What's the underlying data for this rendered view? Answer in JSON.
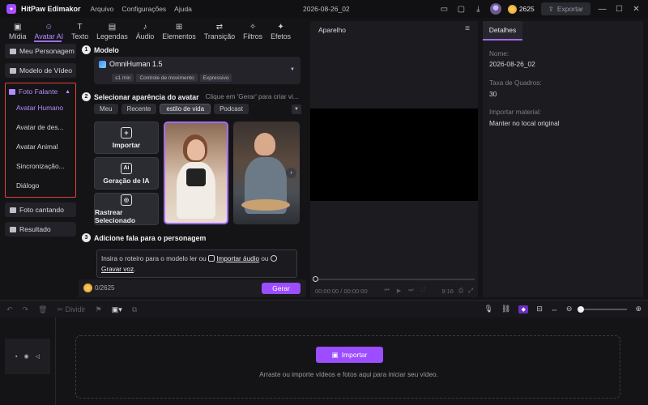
{
  "app": {
    "name": "HitPaw Edimakor",
    "document_title": "2026-08-26_02"
  },
  "menu": [
    "Arquivo",
    "Configurações",
    "Ajuda"
  ],
  "titlebar": {
    "credits": "2625",
    "export_label": "Exportar"
  },
  "tools": [
    {
      "label": "Mídia",
      "icon": "media-icon"
    },
    {
      "label": "Avatar AI",
      "icon": "avatar-ai-icon"
    },
    {
      "label": "Texto",
      "icon": "text-icon"
    },
    {
      "label": "Legendas",
      "icon": "captions-icon"
    },
    {
      "label": "Áudio",
      "icon": "audio-icon"
    },
    {
      "label": "Elementos",
      "icon": "elements-icon"
    },
    {
      "label": "Transição",
      "icon": "transition-icon"
    },
    {
      "label": "Filtros",
      "icon": "filters-icon"
    },
    {
      "label": "Efetos",
      "icon": "effects-icon"
    }
  ],
  "sidebar": {
    "items_top": [
      "Meu Personagem",
      "Modelo de Vídeo"
    ],
    "foto_falante": {
      "label": "Foto Falante",
      "subitems": [
        "Avatar Humano",
        "Avatar de des...",
        "Avatar Animal",
        "Sincronização...",
        "Diálogo"
      ]
    },
    "items_bottom": [
      "Foto cantando",
      "Resultado"
    ]
  },
  "panel": {
    "step1": {
      "num": "1",
      "title": "Modelo"
    },
    "model": {
      "name": "OmniHuman 1.5",
      "tags": [
        "≤1 min",
        "Controle de movimento",
        "Expressivo"
      ]
    },
    "step2": {
      "num": "2",
      "title": "Selecionar aparência do avatar",
      "hint": "Clique em 'Gerar' para criar vi..."
    },
    "filters": [
      "Meu",
      "Recente",
      "estilo de vida",
      "Podcast"
    ],
    "actions": {
      "import": "Importar",
      "ai": "Geração de IA",
      "track": "Rastrear Selecionado"
    },
    "step3": {
      "num": "3",
      "title": "Adicione fala para o personagem"
    },
    "script": {
      "prefix": "Insira o roteiro para o modelo ler ou",
      "import_audio": "Importar áudio",
      "or": "ou",
      "record": "Gravar voz",
      "suffix": "."
    },
    "credits": "0/2625",
    "generate": "Gerar"
  },
  "preview": {
    "title": "Aparelho",
    "time": "00:00:00 / 00:00:00",
    "aspect": "9:16"
  },
  "details": {
    "tab": "Detalhes",
    "name_label": "Nome:",
    "name_value": "2026-08-26_02",
    "fps_label": "Taxa de Quadros:",
    "fps_value": "30",
    "import_label": "Importar material:",
    "import_value": "Manter no local original"
  },
  "timeline": {
    "split_label": "Dividir",
    "import_label": "Importar",
    "hint": "Arraste ou importe vídeos e fotos aqui para iniciar seu vídeo."
  },
  "colors": {
    "accent": "#9b4dff",
    "highlight_border": "#e0413a",
    "background": "#141417"
  }
}
